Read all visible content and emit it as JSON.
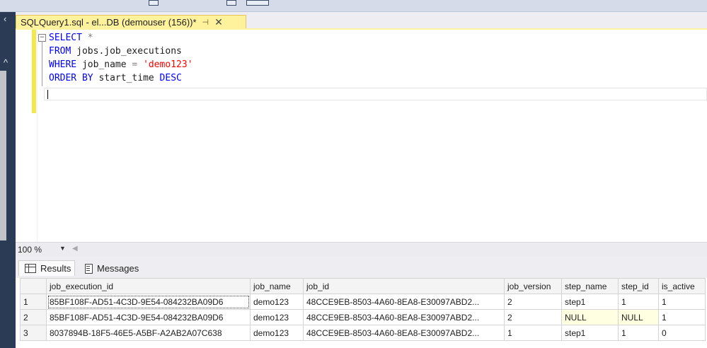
{
  "document_tab": {
    "title": "SQLQuery1.sql - el...DB (demouser (156))*",
    "pin_glyph": "⊣",
    "close_glyph": "✕"
  },
  "editor": {
    "lines": [
      [
        {
          "t": "SELECT",
          "c": "kw"
        },
        {
          "t": " ",
          "c": ""
        },
        {
          "t": "*",
          "c": "op"
        }
      ],
      [
        {
          "t": "FROM",
          "c": "kw"
        },
        {
          "t": " jobs.job_executions",
          "c": ""
        }
      ],
      [
        {
          "t": "WHERE",
          "c": "kw"
        },
        {
          "t": " job_name ",
          "c": ""
        },
        {
          "t": "=",
          "c": "op"
        },
        {
          "t": " ",
          "c": ""
        },
        {
          "t": "'demo123'",
          "c": "str"
        }
      ],
      [
        {
          "t": "ORDER BY",
          "c": "kw"
        },
        {
          "t": " start_time ",
          "c": ""
        },
        {
          "t": "DESC",
          "c": "kw"
        }
      ]
    ]
  },
  "zoom": {
    "value": "100 %"
  },
  "result_tabs": {
    "results": "Results",
    "messages": "Messages"
  },
  "grid": {
    "columns": [
      "job_execution_id",
      "job_name",
      "job_id",
      "job_version",
      "step_name",
      "step_id",
      "is_active"
    ],
    "rows": [
      {
        "n": "1",
        "cells": [
          "85BF108F-AD51-4C3D-9E54-084232BA09D6",
          "demo123",
          "48CCE9EB-8503-4A60-8EA8-E30097ABD2...",
          "2",
          "step1",
          "1",
          "1"
        ]
      },
      {
        "n": "2",
        "cells": [
          "85BF108F-AD51-4C3D-9E54-084232BA09D6",
          "demo123",
          "48CCE9EB-8503-4A60-8EA8-E30097ABD2...",
          "2",
          "NULL",
          "NULL",
          "1"
        ]
      },
      {
        "n": "3",
        "cells": [
          "8037894B-18F5-46E5-A5BF-A2AB2A07C638",
          "demo123",
          "48CCE9EB-8503-4A60-8EA8-E30097ABD2...",
          "1",
          "step1",
          "1",
          "0"
        ]
      }
    ]
  },
  "colors": {
    "tab_yellow": "#fff29d",
    "keyword": "#0000ff",
    "string": "#ff0000",
    "null_cell": "#ffffe1"
  },
  "icons": [
    "collapse-icon",
    "dropdown-icon",
    "grid-icon",
    "messages-icon",
    "close-icon",
    "pin-icon",
    "chevron-left-icon"
  ]
}
